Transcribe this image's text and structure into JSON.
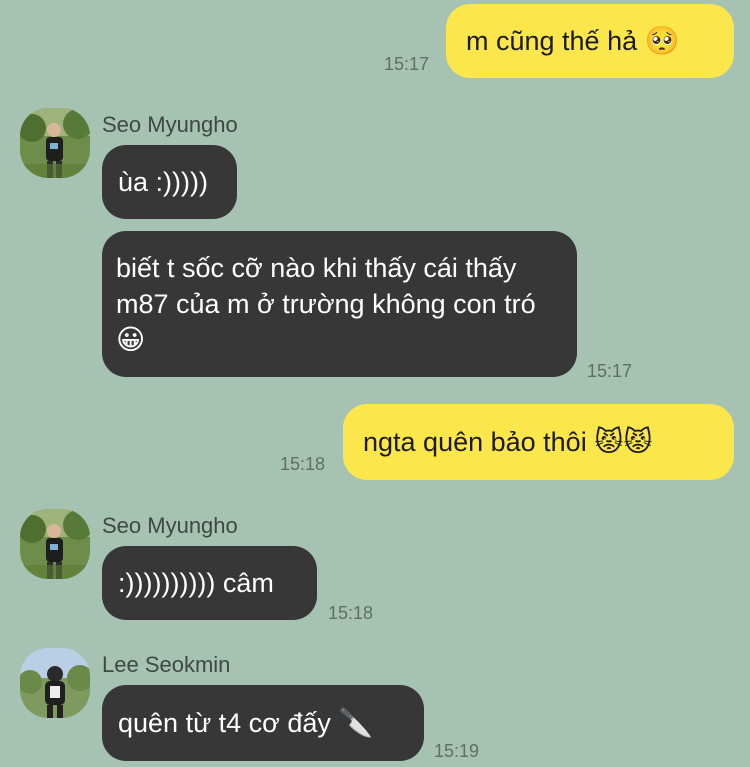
{
  "messages": [
    {
      "text": "m cũng thế hả",
      "emoji": "🥺",
      "time": "15:17"
    },
    {
      "sender": "Seo Myungho",
      "text": "ùa :)))))"
    },
    {
      "text": "biết t sốc cỡ nào khi thấy cái thấy m87 của m ở trường không con tró",
      "emoji": "😀",
      "time": "15:17"
    },
    {
      "text": "ngta quên bảo thôi",
      "emoji": "😾😾",
      "time": "15:18"
    },
    {
      "sender": "Seo Myungho",
      "text": ":)))))))))) câm",
      "time": "15:18"
    },
    {
      "sender": "Lee Seokmin",
      "text": "quên từ t4 cơ đấy",
      "emoji": "🔪",
      "time": "15:19"
    }
  ]
}
